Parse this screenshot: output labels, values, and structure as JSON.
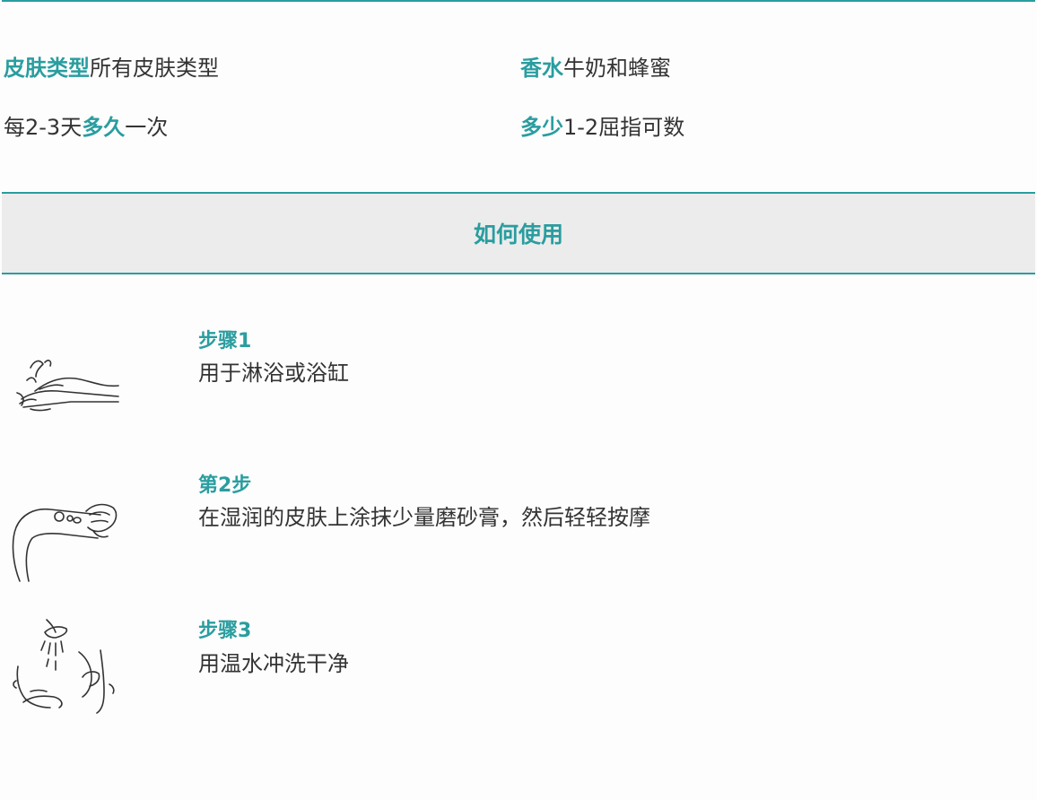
{
  "info": {
    "skin_type_label": "皮肤类型",
    "skin_type_value": "所有皮肤类型",
    "fragrance_label": "香水",
    "fragrance_value": "牛奶和蜂蜜",
    "frequency_prefix": "每2-3天",
    "frequency_label": "多久",
    "frequency_suffix": "一次",
    "amount_label": "多少",
    "amount_value": "1-2屈指可数"
  },
  "section": {
    "title": "如何使用"
  },
  "steps": [
    {
      "title": "步骤1",
      "text": "用于淋浴或浴缸",
      "icon": "hands-water-icon"
    },
    {
      "title": "第2步",
      "text": "在湿润的皮肤上涂抹少量磨砂膏，然后轻轻按摩",
      "icon": "arm-massage-icon"
    },
    {
      "title": "步骤3",
      "text": "用温水冲洗干净",
      "icon": "shower-rinse-icon"
    }
  ],
  "colors": {
    "accent": "#2a9d9f",
    "band": "#ececec",
    "text": "#333333"
  }
}
